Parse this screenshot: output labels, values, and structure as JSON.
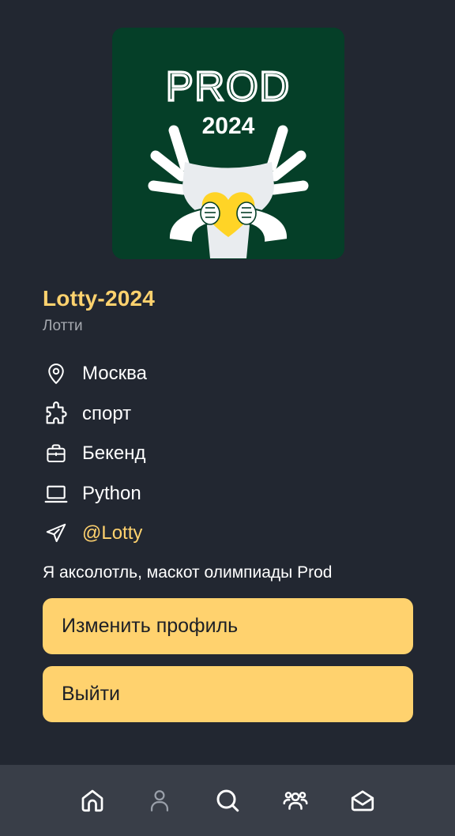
{
  "avatar": {
    "brand_text": "PROD",
    "year_text": "2024",
    "background_color": "#053f28",
    "heart_color": "#ffd426"
  },
  "profile": {
    "username": "Lotty-2024",
    "display_name": "Лотти",
    "bio": "Я аксолотль, маскот олимпиады Prod"
  },
  "info": {
    "city": {
      "icon": "location-pin-icon",
      "text": "Москва"
    },
    "hobby": {
      "icon": "puzzle-icon",
      "text": "спорт"
    },
    "job": {
      "icon": "briefcase-icon",
      "text": "Бекенд"
    },
    "stack": {
      "icon": "laptop-icon",
      "text": "Python"
    },
    "telegram": {
      "icon": "paper-plane-icon",
      "text": "@Lotty"
    }
  },
  "buttons": {
    "edit_label": "Изменить профиль",
    "logout_label": "Выйти"
  },
  "nav": {
    "items": [
      {
        "icon": "home-icon",
        "active": false
      },
      {
        "icon": "profile-icon",
        "active": true
      },
      {
        "icon": "search-icon",
        "active": false
      },
      {
        "icon": "people-icon",
        "active": false
      },
      {
        "icon": "mail-icon",
        "active": false
      }
    ]
  },
  "colors": {
    "background": "#222731",
    "accent": "#ffd26e",
    "nav_background": "#393e48",
    "muted_text": "#a6a9b0"
  }
}
